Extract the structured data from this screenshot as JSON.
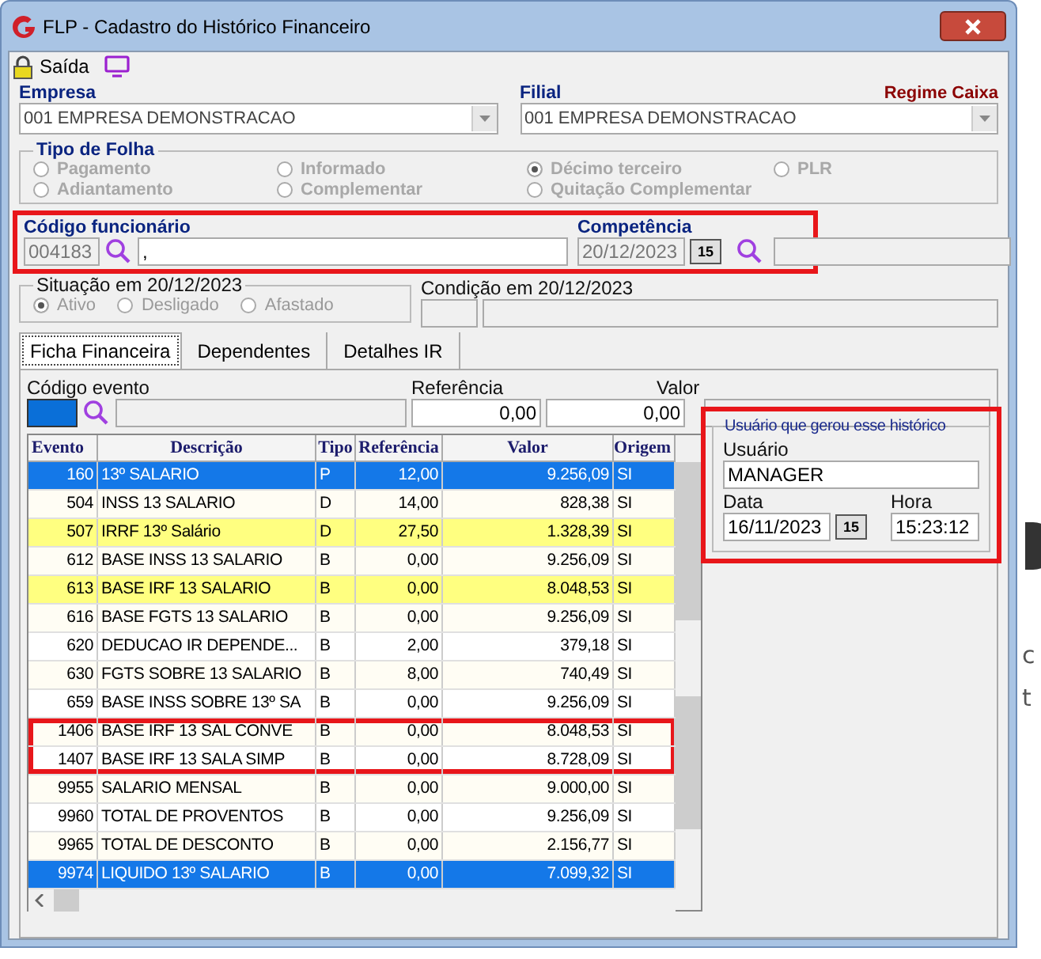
{
  "window": {
    "title": "FLP - Cadastro do Histórico Financeiro"
  },
  "toolbar": {
    "exit_label": "Saída"
  },
  "empresa": {
    "label": "Empresa",
    "value": "001 EMPRESA DEMONSTRACAO"
  },
  "filial": {
    "label": "Filial",
    "value": "001 EMPRESA DEMONSTRACAO"
  },
  "regime": "Regime Caixa",
  "tipo_de_folha": {
    "title": "Tipo de Folha",
    "options": [
      {
        "label": "Pagamento",
        "selected": false
      },
      {
        "label": "Informado",
        "selected": false
      },
      {
        "label": "Décimo terceiro",
        "selected": true
      },
      {
        "label": "PLR",
        "selected": false
      },
      {
        "label": "Adiantamento",
        "selected": false
      },
      {
        "label": "Complementar",
        "selected": false
      },
      {
        "label": "Quitação Complementar",
        "selected": false
      }
    ]
  },
  "funcionario": {
    "highlighted": true,
    "label": "Código funcionário",
    "code": "004183",
    "name": ",",
    "competencia_label": "Competência",
    "competencia": "20/12/2023",
    "calendar": "15"
  },
  "situacao": {
    "title": "Situação em  20/12/2023",
    "options": [
      {
        "label": "Ativo",
        "selected": true
      },
      {
        "label": "Desligado",
        "selected": false
      },
      {
        "label": "Afastado",
        "selected": false
      }
    ]
  },
  "condicao": {
    "label": "Condição em 20/12/2023"
  },
  "tabs": [
    {
      "label": "Ficha Financeira",
      "selected": true
    },
    {
      "label": "Dependentes",
      "selected": false
    },
    {
      "label": "Detalhes IR",
      "selected": false
    }
  ],
  "evento_form": {
    "code_label": "Código evento",
    "ref_label": "Referência",
    "ref_value": "0,00",
    "valor_label": "Valor",
    "valor_value": "0,00"
  },
  "table": {
    "columns": [
      "Evento",
      "Descrição",
      "Tipo",
      "Referência",
      "Valor",
      "Origem"
    ],
    "rows": [
      {
        "cells": [
          "160",
          "13º SALARIO",
          "P",
          "12,00",
          "9.256,09",
          "SI"
        ],
        "selected": true,
        "marked": false,
        "boxed": false
      },
      {
        "cells": [
          "504",
          "INSS 13 SALARIO",
          "D",
          "14,00",
          "828,38",
          "SI"
        ],
        "selected": false,
        "marked": false,
        "boxed": false
      },
      {
        "cells": [
          "507",
          "IRRF 13º Salário",
          "D",
          "27,50",
          "1.328,39",
          "SI"
        ],
        "selected": false,
        "marked": true,
        "boxed": false
      },
      {
        "cells": [
          "612",
          "BASE INSS 13 SALARIO",
          "B",
          "0,00",
          "9.256,09",
          "SI"
        ],
        "selected": false,
        "marked": false,
        "boxed": false
      },
      {
        "cells": [
          "613",
          "BASE IRF 13 SALARIO",
          "B",
          "0,00",
          "8.048,53",
          "SI"
        ],
        "selected": false,
        "marked": true,
        "boxed": false
      },
      {
        "cells": [
          "616",
          "BASE FGTS 13 SALARIO",
          "B",
          "0,00",
          "9.256,09",
          "SI"
        ],
        "selected": false,
        "marked": false,
        "boxed": false
      },
      {
        "cells": [
          "620",
          "DEDUCAO IR DEPENDE...",
          "B",
          "2,00",
          "379,18",
          "SI"
        ],
        "selected": false,
        "marked": false,
        "boxed": false
      },
      {
        "cells": [
          "630",
          "FGTS SOBRE 13 SALARIO",
          "B",
          "8,00",
          "740,49",
          "SI"
        ],
        "selected": false,
        "marked": false,
        "boxed": false
      },
      {
        "cells": [
          "659",
          "BASE INSS SOBRE 13º SA",
          "B",
          "0,00",
          "9.256,09",
          "SI"
        ],
        "selected": false,
        "marked": false,
        "boxed": false
      },
      {
        "cells": [
          "1406",
          "BASE IRF  13 SAL CONVE",
          "B",
          "0,00",
          "8.048,53",
          "SI"
        ],
        "selected": false,
        "marked": false,
        "boxed": true
      },
      {
        "cells": [
          "1407",
          "BASE IRF  13 SALA SIMP",
          "B",
          "0,00",
          "8.728,09",
          "SI"
        ],
        "selected": false,
        "marked": false,
        "boxed": true
      },
      {
        "cells": [
          "9955",
          "SALARIO MENSAL",
          "B",
          "0,00",
          "9.000,00",
          "SI"
        ],
        "selected": false,
        "marked": false,
        "boxed": false
      },
      {
        "cells": [
          "9960",
          "TOTAL DE PROVENTOS",
          "B",
          "0,00",
          "9.256,09",
          "SI"
        ],
        "selected": false,
        "marked": false,
        "boxed": false
      },
      {
        "cells": [
          "9965",
          "TOTAL DE DESCONTO",
          "B",
          "0,00",
          "2.156,77",
          "SI"
        ],
        "selected": false,
        "marked": false,
        "boxed": false
      },
      {
        "cells": [
          "9974",
          "LIQUIDO 13º SALARIO",
          "B",
          "0,00",
          "7.099,32",
          "SI"
        ],
        "selected": true,
        "marked": false,
        "boxed": false
      }
    ]
  },
  "usuario_box": {
    "highlighted": true,
    "title": "Usuário que gerou esse histórico",
    "user_label": "Usuário",
    "user": "MANAGER",
    "date_label": "Data",
    "date": "16/11/2023",
    "calendar": "15",
    "time_label": "Hora",
    "time": "15:23:12"
  },
  "background_fragments": [
    "c",
    "t"
  ]
}
